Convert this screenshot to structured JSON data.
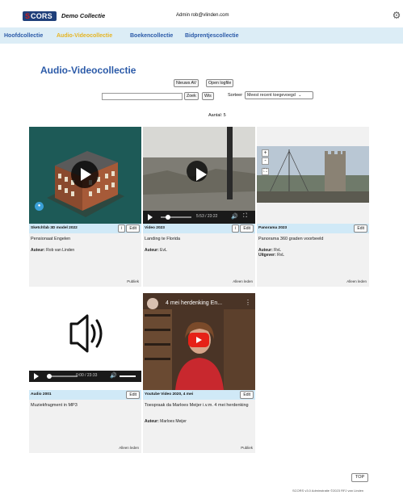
{
  "header": {
    "logo_s": "S",
    "logo_rest": "CORS",
    "app_title": "Demo Collectie",
    "admin": "Admin rob@vlinden.com",
    "settings_icon": "gear-icon"
  },
  "nav": {
    "items": [
      {
        "label": "Hoofdcollectie",
        "active": false
      },
      {
        "label": "Audio-Videocollectie",
        "active": true
      },
      {
        "label": "Boekencollectie",
        "active": false
      },
      {
        "label": "Bidprentjescollectie",
        "active": false
      }
    ]
  },
  "page": {
    "title": "Audio-Videocollectie",
    "new_button": "Nieuws AV",
    "log_button": "Open logfile",
    "search_placeholder": "",
    "search_button": "Zoek",
    "clear_button": "Wis",
    "sort_label": "Sorteer",
    "sort_value": "Meest recent toegevoegd",
    "count": "Aantal: 5"
  },
  "cards": [
    {
      "title": "Sketchfab 3D model  2022",
      "has_info": true,
      "edit": "Edit",
      "desc": "Pensionaat Engelen",
      "meta": [
        {
          "label": "Auteur:",
          "value": "Rob van Linden"
        }
      ],
      "access": "Publiek"
    },
    {
      "title": "Video  2023",
      "has_info": true,
      "edit": "Edit",
      "desc": "Landing te Florida",
      "meta": [
        {
          "label": "Auteur:",
          "value": "EvL"
        }
      ],
      "access": "Alleen leden",
      "time": "5:53 / 23:22"
    },
    {
      "title": "Panorama 2023",
      "has_info": false,
      "edit": "Edit",
      "desc": "Panorama 360 graden voorbeeld",
      "meta": [
        {
          "label": "Auteur:",
          "value": "RvL"
        },
        {
          "label": "Uitgever:",
          "value": "RvL"
        }
      ],
      "access": "Alleen leden",
      "zoom_in": "+",
      "zoom_out": "-"
    },
    {
      "title": "Audio  2001",
      "has_info": false,
      "edit": "Edit",
      "desc": "Muziekfragment in MP3",
      "meta": [],
      "access": "Alleen leden",
      "time": "0:00 / 23:33"
    },
    {
      "title": "Youtube Video  2020, 4 mei",
      "has_info": false,
      "edit": "Edit",
      "desc": "Toespraak da Marloes Meijer i.v.m. 4 mei herdenking",
      "meta": [
        {
          "label": "Auteur:",
          "value": "Marloes Meijer"
        }
      ],
      "access": "Publiek",
      "yt_title": "4 mei herdenking En..."
    }
  ],
  "footer": {
    "top_button": "TOP",
    "copyright": "SCORS v3.0 Adminstratie ©2023 RFJ van Linden"
  },
  "colors": {
    "nav_bg": "#dcedf6",
    "nav_link": "#2b5aa8",
    "nav_active": "#e6b422",
    "card_strip": "#d0e9f7",
    "title": "#2b5aa8"
  }
}
